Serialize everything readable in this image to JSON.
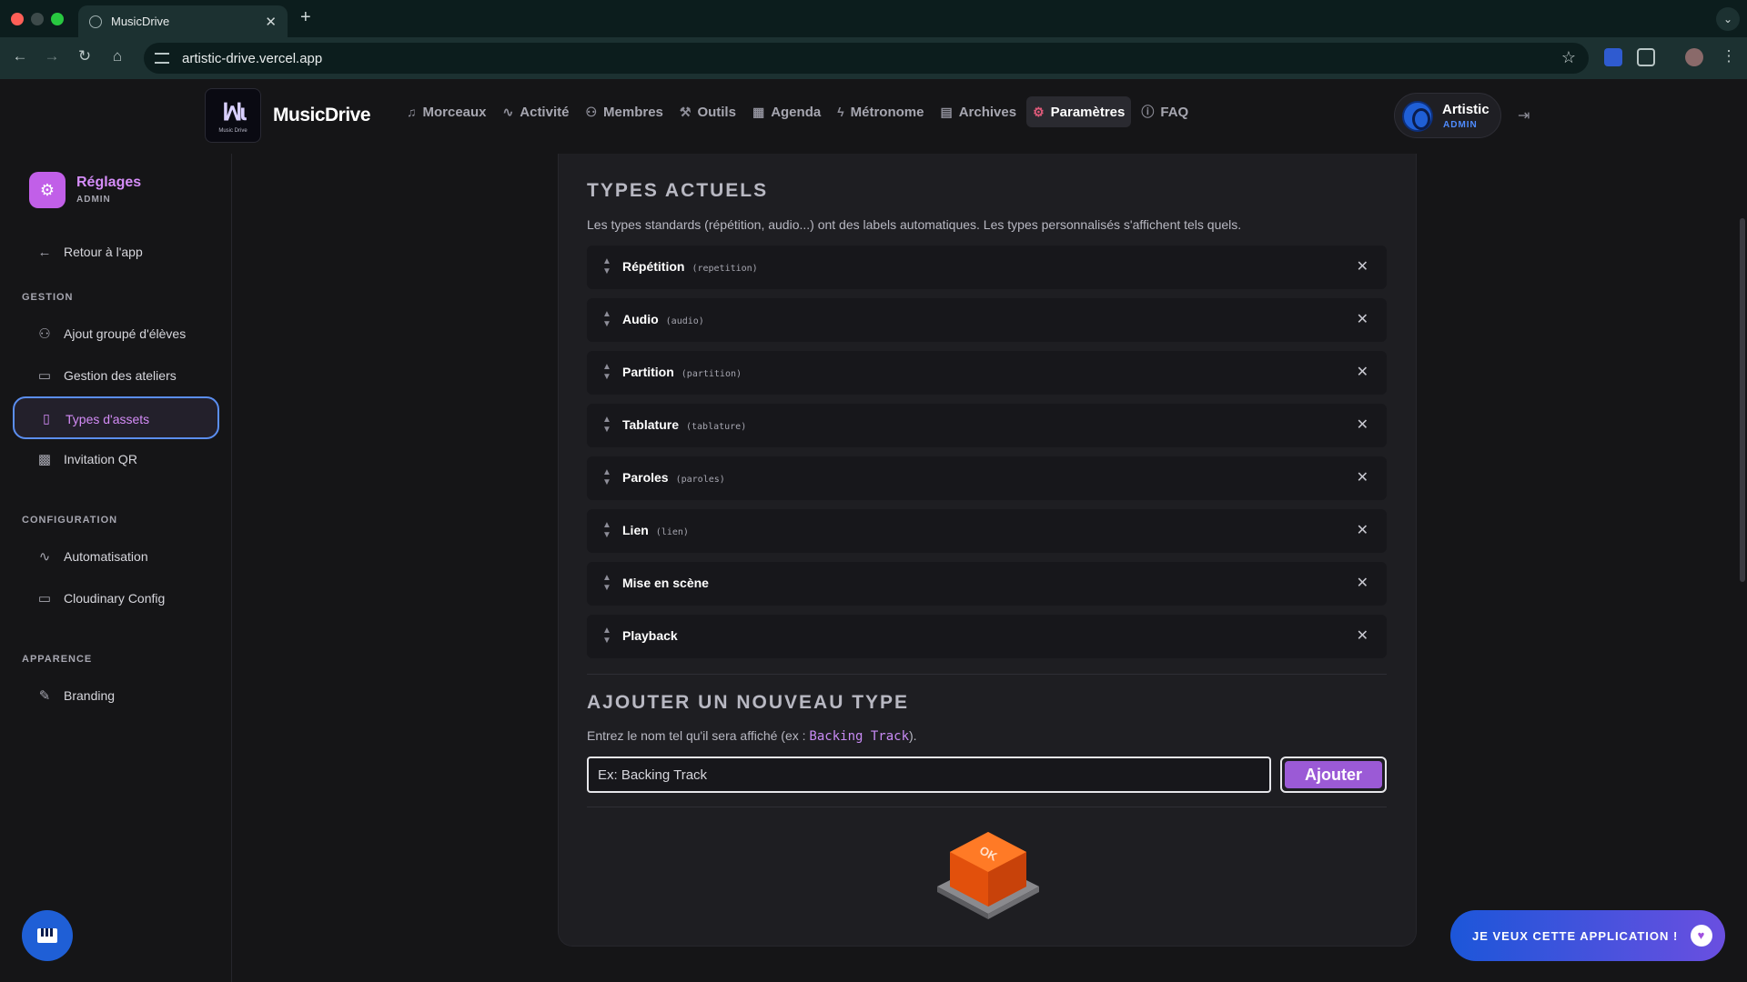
{
  "browser": {
    "tab_title": "MusicDrive",
    "tab_close": "✕",
    "new_tab": "+",
    "url": "artistic-drive.vercel.app"
  },
  "header": {
    "logo_mark": "ꟽɩ",
    "logo_caption": "Music Drive",
    "brand": "MusicDrive",
    "nav": [
      {
        "label": "Morceaux",
        "icon": "music-note-icon"
      },
      {
        "label": "Activité",
        "icon": "activity-icon"
      },
      {
        "label": "Membres",
        "icon": "users-icon"
      },
      {
        "label": "Outils",
        "icon": "wrench-icon"
      },
      {
        "label": "Agenda",
        "icon": "calendar-icon"
      },
      {
        "label": "Métronome",
        "icon": "lightning-icon"
      },
      {
        "label": "Archives",
        "icon": "archive-icon"
      },
      {
        "label": "Paramètres",
        "icon": "gear-icon",
        "active": true
      },
      {
        "label": "FAQ",
        "icon": "help-circle-icon"
      }
    ],
    "user": {
      "name": "Artistic",
      "role": "ADMIN"
    }
  },
  "sidebar": {
    "title": "Réglages",
    "subtitle": "ADMIN",
    "back": "Retour à l'app",
    "sections": {
      "gestion": "GESTION",
      "configuration": "CONFIGURATION",
      "apparence": "APPARENCE"
    },
    "items": {
      "ajout": "Ajout groupé d'élèves",
      "ateliers": "Gestion des ateliers",
      "types": "Types d'assets",
      "qr": "Invitation QR",
      "automatisation": "Automatisation",
      "cloudinary": "Cloudinary Config",
      "branding": "Branding"
    }
  },
  "main": {
    "current_title": "TYPES ACTUELS",
    "current_hint": "Les types standards (répétition, audio...) ont des labels automatiques. Les types personnalisés s'affichent tels quels.",
    "types": [
      {
        "name": "Répétition",
        "slug": "(repetition)"
      },
      {
        "name": "Audio",
        "slug": "(audio)"
      },
      {
        "name": "Partition",
        "slug": "(partition)"
      },
      {
        "name": "Tablature",
        "slug": "(tablature)"
      },
      {
        "name": "Paroles",
        "slug": "(paroles)"
      },
      {
        "name": "Lien",
        "slug": "(lien)"
      },
      {
        "name": "Mise en scène",
        "slug": ""
      },
      {
        "name": "Playback",
        "slug": ""
      }
    ],
    "remove_symbol": "✕",
    "add_title": "AJOUTER UN NOUVEAU TYPE",
    "add_hint_prefix": "Entrez le nom tel qu'il sera affiché (ex : ",
    "add_hint_code": "Backing Track",
    "add_hint_suffix": ").",
    "input_placeholder": "Ex: Backing Track",
    "add_button": "Ajouter",
    "ok_key_label": "OK"
  },
  "cta": {
    "label": "JE VEUX CETTE APPLICATION !",
    "heart": "♥"
  },
  "colors": {
    "accent": "#c15fe8",
    "primary_blue": "#1f5fd6",
    "active_nav": "#e05a7a"
  }
}
